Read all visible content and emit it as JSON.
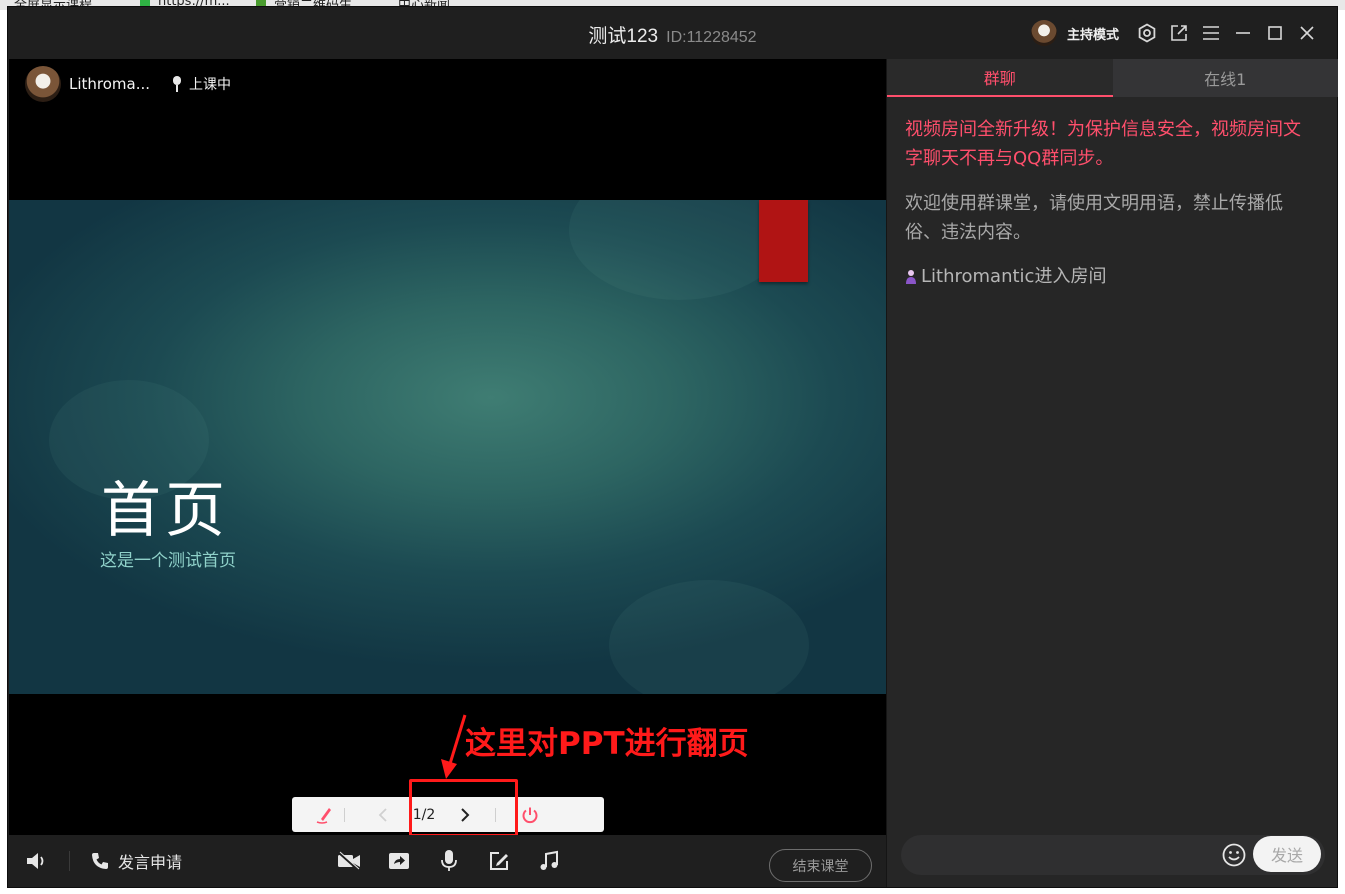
{
  "background_tabs": [
    "全屏显示课程",
    "https://m...",
    "营销二维码生...",
    "中心新闻"
  ],
  "window": {
    "title": "测试123",
    "room_id": "ID:11228452",
    "host_mode_label": "主持模式"
  },
  "stage": {
    "user_name": "Lithroma...",
    "status": "上课中",
    "slide": {
      "title": "首页",
      "subtitle": "这是一个测试首页",
      "accent_color": "#b01414"
    },
    "annotation_text": "这里对PPT进行翻页",
    "pager": {
      "current": "1/2"
    }
  },
  "bottom_bar": {
    "apply_speak_label": "发言申请",
    "end_class_label": "结束课堂"
  },
  "right_panel": {
    "tabs": [
      {
        "label": "群聊",
        "active": true
      },
      {
        "label": "在线1",
        "active": false
      }
    ],
    "messages": {
      "system_notice": "视频房间全新升级！为保护信息安全，视频房间文字聊天不再与QQ群同步。",
      "welcome": "欢迎使用群课堂，请使用文明用语，禁止传播低俗、违法内容。",
      "enter_user": "Lithromantic",
      "enter_text": " 进入房间"
    },
    "input": {
      "placeholder": "",
      "value": ""
    },
    "send_label": "发送"
  },
  "colors": {
    "accent_pink": "#ff4f6c",
    "annotation_red": "#ff1a1a",
    "window_bg": "#1f1f1f",
    "panel_bg": "#262626"
  }
}
